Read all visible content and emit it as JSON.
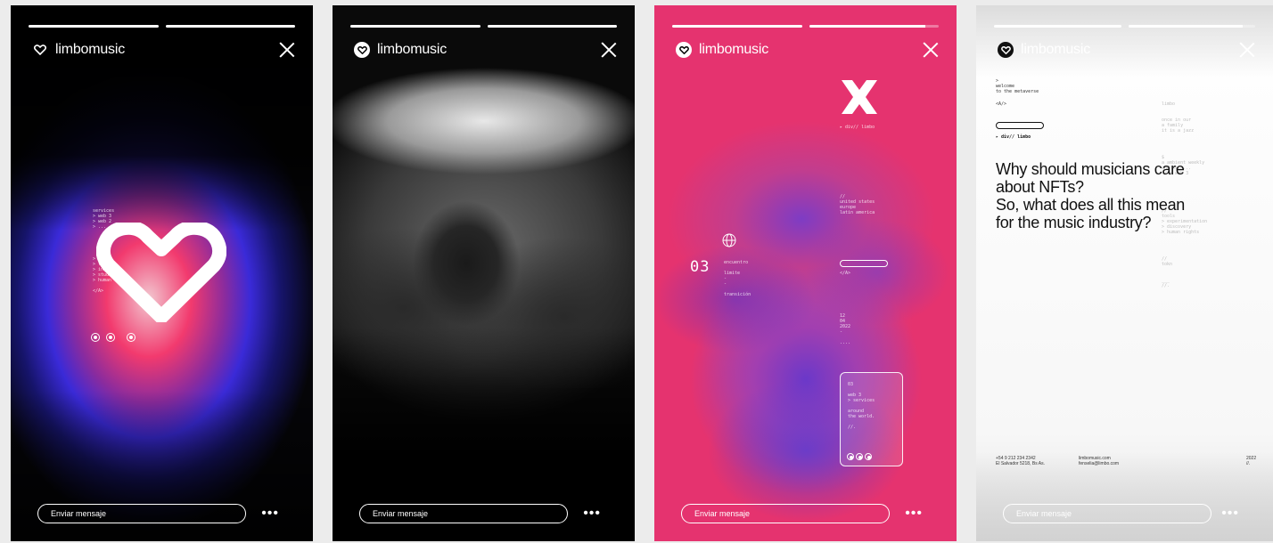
{
  "brand": "limbomusic",
  "message_placeholder": "Enviar mensaje",
  "more_label": "•••",
  "story1": {
    "progress": [
      1.0,
      1.0
    ],
    "code_lines": [
      "services",
      "",
      "> web 3",
      "> web 2",
      "> ...",
      "",
      "",
      "",
      "",
      "",
      "> ...",
      "> tools",
      "> inter...",
      "> studio",
      "> human live",
      "",
      "</A>"
    ]
  },
  "story2": {
    "progress": [
      1.0,
      1.0
    ]
  },
  "story3": {
    "progress": [
      1.0,
      0.9
    ],
    "tag1": "▸ div// limbo",
    "regions": [
      "//",
      "united states",
      "europe",
      "latin america"
    ],
    "num": "03",
    "labels": [
      "encuentro",
      "",
      "limite",
      "-",
      "-",
      "",
      "transición"
    ],
    "close_tag": "</A>",
    "date": [
      "12",
      "04",
      "2022",
      "-",
      "",
      "...."
    ],
    "card": [
      "03",
      "",
      "web 3",
      "> services",
      "",
      "around",
      "the world.",
      "",
      "//."
    ]
  },
  "story4": {
    "progress": [
      1.0,
      0.9
    ],
    "intro": [
      ">",
      "welcome",
      "to the metaverse"
    ],
    "anchor": "<A/>",
    "tag": "▸ div// limbo",
    "right_col": [
      "limbo",
      "",
      "",
      "once in our",
      "a family",
      "it is a jazz",
      "",
      "",
      "",
      "",
      "$",
      "a ambient weekly",
      "and kick...",
      "</A>   web 3",
      "",
      "",
      "",
      "",
      "",
      "",
      "//",
      "tools",
      "> experimentation",
      "> discovery",
      "> human rights",
      "",
      "",
      "",
      "",
      "//",
      "tokn",
      "",
      "",
      "___",
      "//."
    ],
    "headline": [
      "Why should musicians care",
      "about NFTs?",
      "So, what does all this mean",
      "for the music industry?"
    ],
    "phone": "+54 9 212 234 2342",
    "address": "El Salvador 5218, Bs As.",
    "web": "limbomusic.com",
    "email": "fenselia@limbo.com",
    "year": "2022",
    "year_sub": "//."
  }
}
